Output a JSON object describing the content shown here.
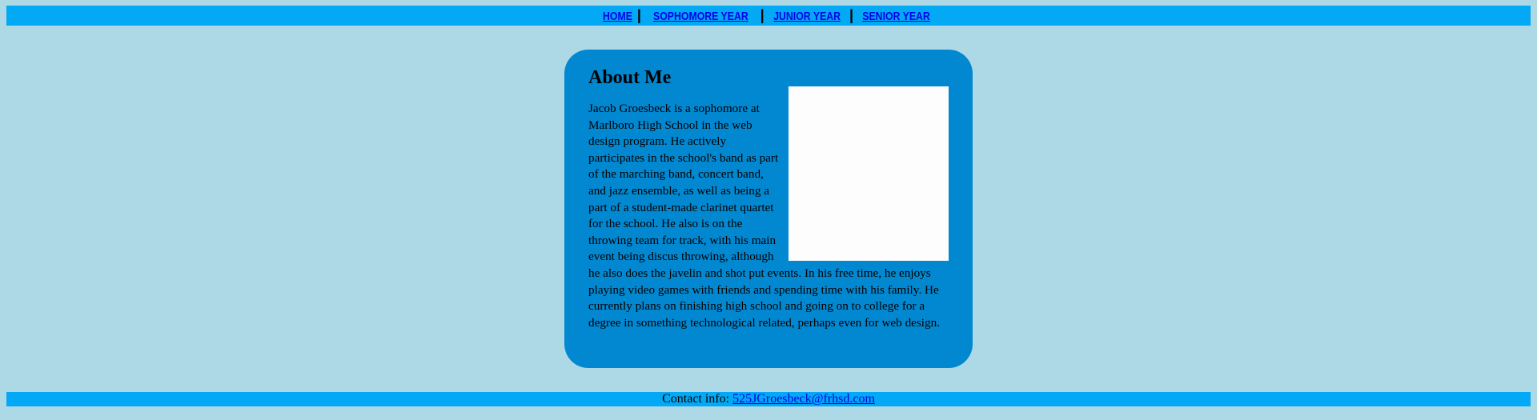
{
  "nav": {
    "items": [
      {
        "label": "HOME"
      },
      {
        "label": "SOPHOMORE YEAR"
      },
      {
        "label": "JUNIOR YEAR"
      },
      {
        "label": "SENIOR YEAR"
      }
    ],
    "separator": "|"
  },
  "about": {
    "heading": "About Me",
    "body": "Jacob Groesbeck is a sophomore at Marlboro High School in the web design program. He actively participates in the school's band as part of the marching band, concert band, and jazz ensemble, as well as being a part of a student-made clarinet quartet for the school. He also is on the throwing team for track, with his main event being discus throwing, although he also does the javelin and shot put events. In his free time, he enjoys playing video games with friends and spending time with his family. He currently plans on finishing high school and going on to college for a degree in something technological related, perhaps even for web design."
  },
  "footer": {
    "label": "Contact info:",
    "email": "525JGroesbeck@frhsd.com"
  },
  "colors": {
    "background": "#add8e6",
    "bar": "#03a9f4",
    "card": "#0288d1",
    "link": "#0000ee"
  }
}
